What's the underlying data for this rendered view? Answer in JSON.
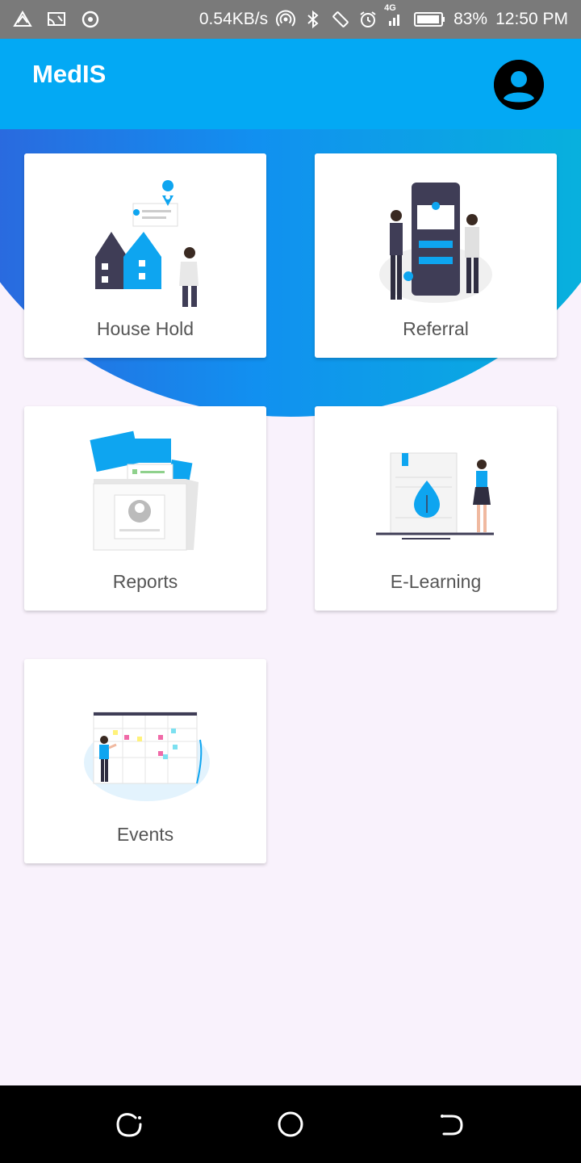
{
  "status_bar": {
    "net_speed": "0.54KB/s",
    "network_badge": "4G",
    "battery": "83%",
    "time": "12:50 PM",
    "icons": [
      "warning-triangle-icon",
      "cast-icon",
      "target-icon",
      "hotspot-icon",
      "bluetooth-icon",
      "rotation-icon",
      "alarm-icon",
      "signal-icon",
      "battery-icon"
    ]
  },
  "app_bar": {
    "title": "MedIS",
    "profile_icon": "account-circle-icon"
  },
  "colors": {
    "app_bar": "#03a9f4",
    "accent_blue": "#0ea5f0",
    "dark_navy": "#3f3d56",
    "background": "#f9f2fc"
  },
  "cards": [
    {
      "label": "House Hold"
    },
    {
      "label": "Referral"
    },
    {
      "label": "Reports"
    },
    {
      "label": "E-Learning"
    },
    {
      "label": "Events"
    }
  ],
  "nav_bar": {
    "buttons": [
      "recent-apps-icon",
      "home-circle-icon",
      "back-icon"
    ]
  }
}
